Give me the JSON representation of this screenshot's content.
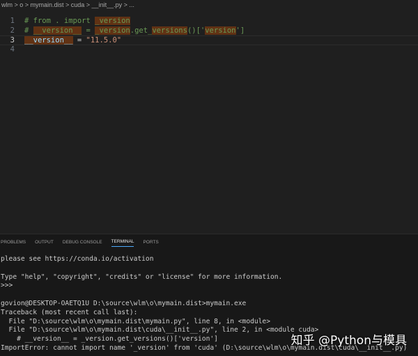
{
  "breadcrumb": "wlm > o > mymain.dist > cuda > __init__.py > ...",
  "editor": {
    "lines": [
      {
        "num": "1",
        "parts": [
          [
            "cm",
            "# from . import "
          ],
          [
            "cm hl",
            "_version"
          ]
        ]
      },
      {
        "num": "2",
        "parts": [
          [
            "cm",
            "# "
          ],
          [
            "cm hl",
            "__version__"
          ],
          [
            "cm",
            " = "
          ],
          [
            "cm hl",
            "_version"
          ],
          [
            "cm",
            ".get_"
          ],
          [
            "cm hl",
            "versions"
          ],
          [
            "cm",
            "()['"
          ],
          [
            "cm hl",
            "version"
          ],
          [
            "cm",
            "']"
          ]
        ]
      },
      {
        "num": "3",
        "parts": [
          [
            "id hl",
            "__version__"
          ],
          [
            "op",
            " = "
          ],
          [
            "st",
            "\"11.5.0\""
          ]
        ]
      },
      {
        "num": "4",
        "parts": []
      }
    ]
  },
  "panel": {
    "tabs": [
      "PROBLEMS",
      "OUTPUT",
      "DEBUG CONSOLE",
      "TERMINAL",
      "PORTS"
    ],
    "active": "TERMINAL"
  },
  "terminal": {
    "lines": [
      "please see https://conda.io/activation",
      "",
      "Type \"help\", \"copyright\", \"credits\" or \"license\" for more information.",
      ">>>",
      "",
      "govion@DESKTOP-OAETQ1U D:\\source\\wlm\\o\\mymain.dist>mymain.exe",
      "Traceback (most recent call last):",
      "  File \"D:\\source\\wlm\\o\\mymain.dist\\mymain.py\", line 8, in <module>",
      "  File \"D:\\source\\wlm\\o\\mymain.dist\\cuda\\__init__.py\", line 2, in <module cuda>",
      "    # __version__ = _version.get_versions()['version']",
      "ImportError: cannot import name '_version' from 'cuda' (D:\\source\\wlm\\o\\mymain.dist\\cuda\\__init__.py)"
    ]
  },
  "watermark": "知乎 @Python与模具"
}
